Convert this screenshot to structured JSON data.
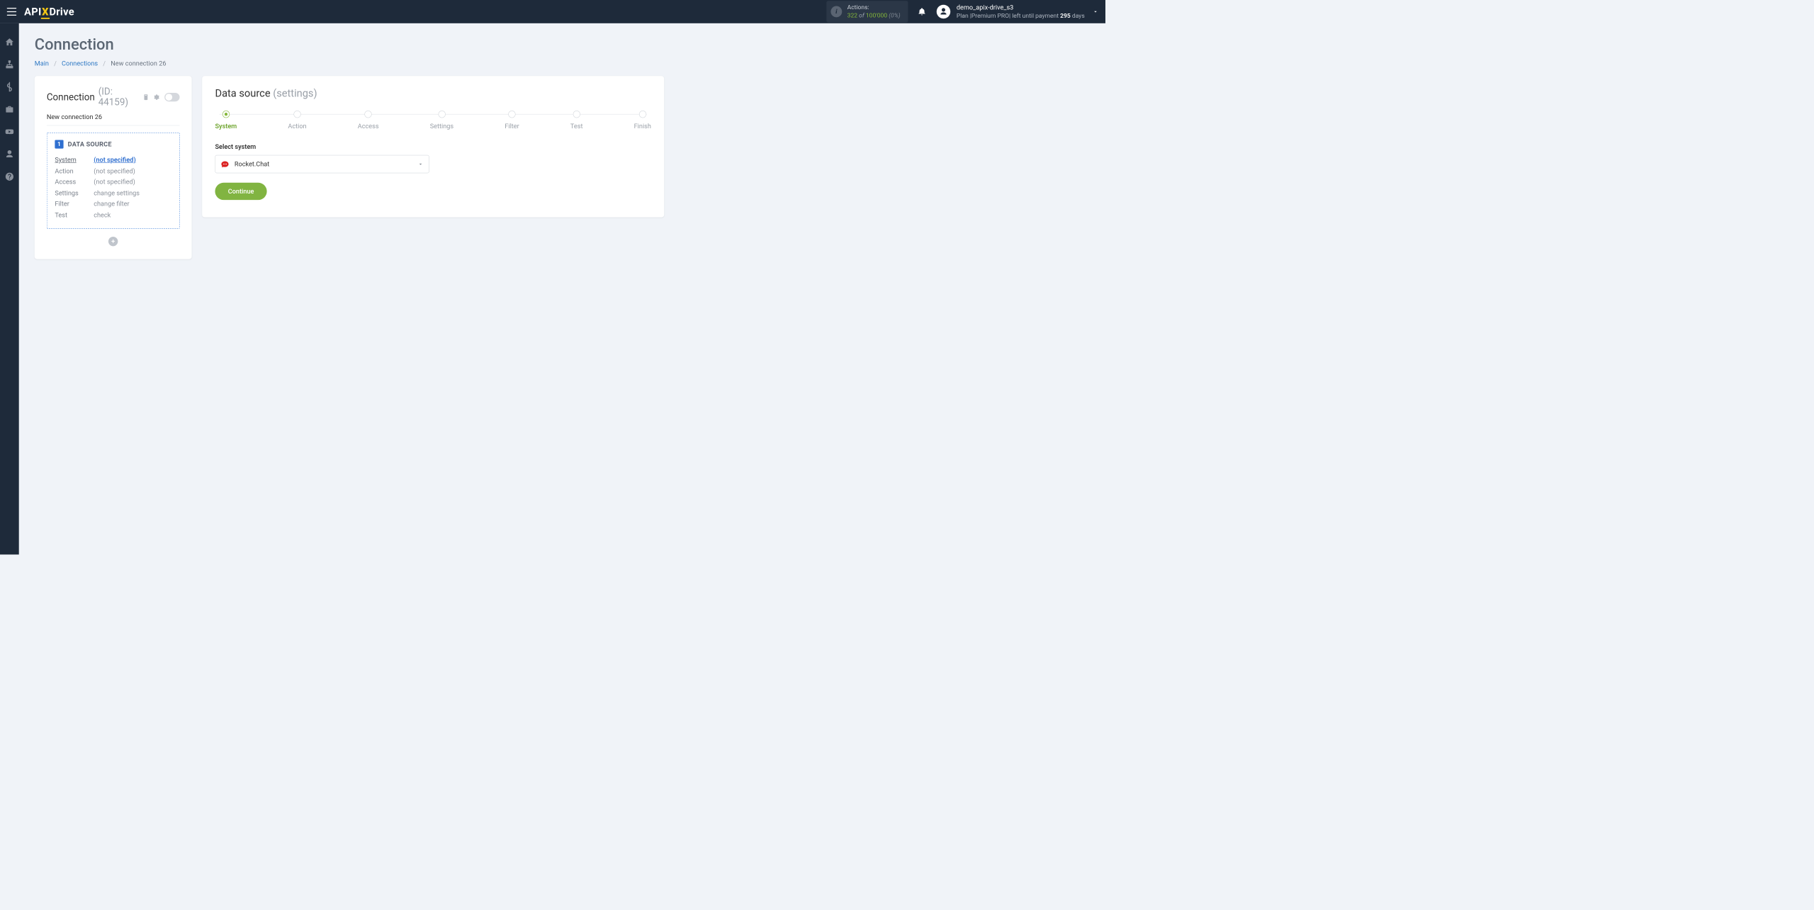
{
  "header": {
    "logo_part1": "API",
    "logo_x": "X",
    "logo_part2": "Drive",
    "actions": {
      "label": "Actions:",
      "used": "322",
      "of": "of",
      "quota": "100'000",
      "pct": "(0%)"
    },
    "user": {
      "name": "demo_apix-drive_s3",
      "plan_prefix": "Plan |",
      "plan_name": "Premium PRO",
      "plan_mid": "| left until payment ",
      "days_num": "295",
      "days_word": " days"
    }
  },
  "page": {
    "title": "Connection",
    "breadcrumb": {
      "main": "Main",
      "connections": "Connections",
      "current": "New connection 26"
    }
  },
  "left_card": {
    "title": "Connection ",
    "id": "(ID: 44159)",
    "name": "New connection 26",
    "ds_badge": "1",
    "ds_title": "DATA SOURCE",
    "rows": [
      {
        "k": "System",
        "v": "(not specified)",
        "active": true,
        "link": true
      },
      {
        "k": "Action",
        "v": "(not specified)"
      },
      {
        "k": "Access",
        "v": "(not specified)"
      },
      {
        "k": "Settings",
        "v": "change settings"
      },
      {
        "k": "Filter",
        "v": "change filter"
      },
      {
        "k": "Test",
        "v": "check"
      }
    ]
  },
  "right_card": {
    "title": "Data source ",
    "subtitle": "(settings)",
    "steps": [
      "System",
      "Action",
      "Access",
      "Settings",
      "Filter",
      "Test",
      "Finish"
    ],
    "active_step": 0,
    "field_label": "Select system",
    "selected_system": "Rocket.Chat",
    "continue": "Continue"
  },
  "sidebar_icons": [
    "home",
    "sitemap",
    "dollar",
    "briefcase",
    "youtube",
    "user",
    "help"
  ]
}
